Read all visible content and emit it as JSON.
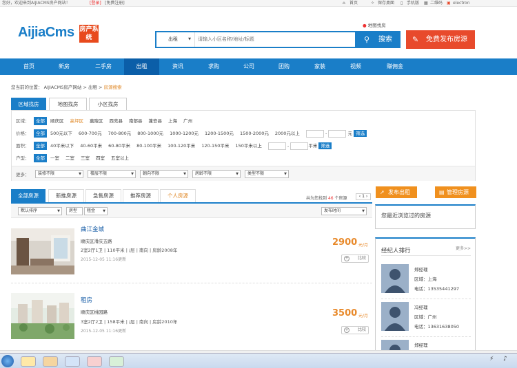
{
  "topbar": {
    "welcome": "您好，欢迎来到AIJIACMS房产网站！",
    "login": "[登录]",
    "register": "[免费注册]",
    "links": [
      "首页",
      "保存桌面",
      "手机版",
      "二维码",
      "electron"
    ]
  },
  "header": {
    "logo_main": "AijiaCms",
    "logo_badge": "房产系统",
    "map_link": "地图找房",
    "search_type": "出租",
    "search_placeholder": "请输入小区名称/地址/标题",
    "search_button": "搜索",
    "publish_button": "免费发布房源"
  },
  "nav": [
    "首页",
    "新房",
    "二手房",
    "出租",
    "资讯",
    "求购",
    "公司",
    "团购",
    "家装",
    "视频",
    "赚佣金"
  ],
  "breadcrumb": {
    "prefix": "您当前的位置：",
    "site": "AIJIACMS房产网站",
    "level2": "出租",
    "current": "房源搜索"
  },
  "filter_tabs": [
    "区域找房",
    "地图找房",
    "小区找房"
  ],
  "filters": {
    "area": {
      "label": "区域：",
      "all": "全部",
      "options": [
        "顺庆区",
        "高坪区",
        "嘉陵区",
        "西充县",
        "南部县",
        "蓬安县",
        "上海",
        "广州"
      ]
    },
    "price": {
      "label": "价格：",
      "all": "全部",
      "options": [
        "500元以下",
        "600-700元",
        "700-800元",
        "800-1000元",
        "1000-1200元",
        "1200-1500元",
        "1500-2000元",
        "2000元以上"
      ],
      "unit": "元",
      "button": "筛选"
    },
    "size": {
      "label": "面积：",
      "all": "全部",
      "options": [
        "40平米以下",
        "40-60平米",
        "60-80平米",
        "80-100平米",
        "100-120平米",
        "120-150平米",
        "150平米以上"
      ],
      "unit": "平米",
      "button": "筛选"
    },
    "layout": {
      "label": "户型：",
      "all": "全部",
      "options": [
        "一室",
        "二室",
        "三室",
        "四室",
        "五室以上"
      ]
    },
    "more_label": "更多：",
    "selects": [
      "装修不限",
      "楼层不限",
      "朝向不限",
      "房龄不限",
      "类型不限"
    ]
  },
  "result_tabs": [
    "全部房源",
    "新推房源",
    "急售房源",
    "推荐房源",
    "个人房源"
  ],
  "count": {
    "prefix": "共为您找到",
    "value": "46",
    "suffix": "个房源",
    "pager": "1"
  },
  "sortbar": {
    "sort": "默认排序",
    "room": "房型",
    "rent": "租金",
    "time": "发布时间"
  },
  "listings": [
    {
      "title": "曲江金城",
      "area": "顺庆区滑庆五路",
      "meta": "2室2厅1卫  |  110平米  |  /层  |  南向  |  房龄2008年",
      "date": "2015-12-05 11:16更新",
      "price": "2900",
      "unit": "元/月",
      "compare": "比较"
    },
    {
      "title": "租房",
      "area": "顺庆区桃园路",
      "meta": "3室2厅2卫  |  158平米  |  /层  |  南向  |  房龄2010年",
      "date": "2015-12-05 11:16更新",
      "price": "3500",
      "unit": "元/月",
      "compare": "比较"
    }
  ],
  "sidebar": {
    "rent_button": "发布出租",
    "manage_button": "管理房源",
    "viewed_title": "您最近浏览过的房源",
    "agents_title": "经纪人排行",
    "agents_more": "更多>>",
    "agents": [
      {
        "name": "郑经理",
        "area": "区域：上海",
        "phone": "电话：13535441297"
      },
      {
        "name": "冯经理",
        "area": "区域：广州",
        "phone": "电话：13631638050"
      },
      {
        "name": "郑经理",
        "area": "",
        "phone": ""
      }
    ]
  },
  "colors": {
    "brand": "#1a7ec8",
    "accent_orange": "#e8892a",
    "publish_red": "#e84a2c"
  }
}
